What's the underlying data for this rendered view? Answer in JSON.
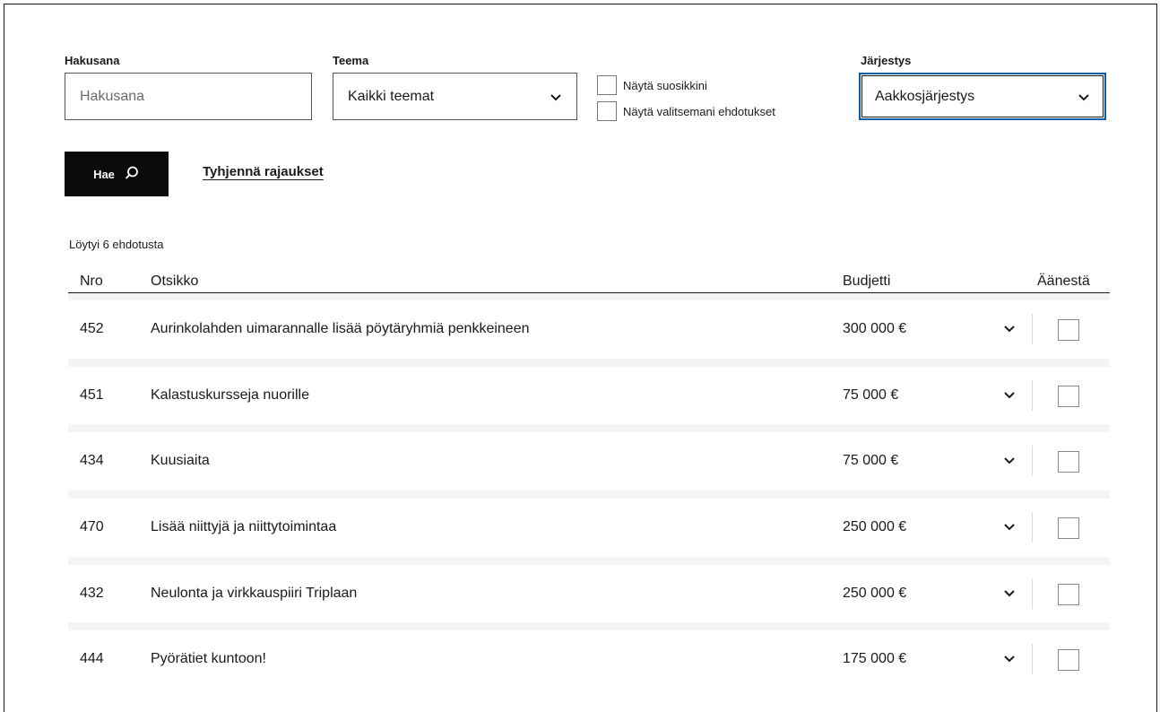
{
  "filters": {
    "keyword": {
      "label": "Hakusana",
      "placeholder": "Hakusana",
      "value": ""
    },
    "theme": {
      "label": "Teema",
      "selected": "Kaikki teemat"
    },
    "show_favorites": {
      "label": "Näytä suosikkini",
      "checked": false
    },
    "show_selected": {
      "label": "Näytä valitsemani ehdotukset",
      "checked": false
    },
    "order": {
      "label": "Järjestys",
      "selected": "Aakkosjärjestys"
    }
  },
  "actions": {
    "search_label": "Hae",
    "clear_label": "Tyhjennä rajaukset"
  },
  "results": {
    "count_text": "Löytyi 6 ehdotusta",
    "columns": {
      "number": "Nro",
      "title": "Otsikko",
      "budget": "Budjetti",
      "vote": "Äänestä"
    },
    "rows": [
      {
        "number": "452",
        "title": "Aurinkolahden uimarannalle lisää pöytäryhmiä penkkeineen",
        "budget": "300 000 €"
      },
      {
        "number": "451",
        "title": "Kalastuskursseja nuorille",
        "budget": "75 000 €"
      },
      {
        "number": "434",
        "title": "Kuusiaita",
        "budget": "75 000 €"
      },
      {
        "number": "470",
        "title": "Lisää niittyjä ja niittytoimintaa",
        "budget": "250 000 €"
      },
      {
        "number": "432",
        "title": "Neulonta ja virkkauspiiri Triplaan",
        "budget": "250 000 €"
      },
      {
        "number": "444",
        "title": "Pyörätiet kuntoon!",
        "budget": "175 000 €"
      }
    ]
  },
  "icons": {
    "search": "search-icon",
    "chevron": "chevron-down-icon"
  },
  "colors": {
    "focus_border": "#0a5ea8",
    "button_bg": "#0b0b0b",
    "row_gap_bg": "#f4f4f4"
  }
}
